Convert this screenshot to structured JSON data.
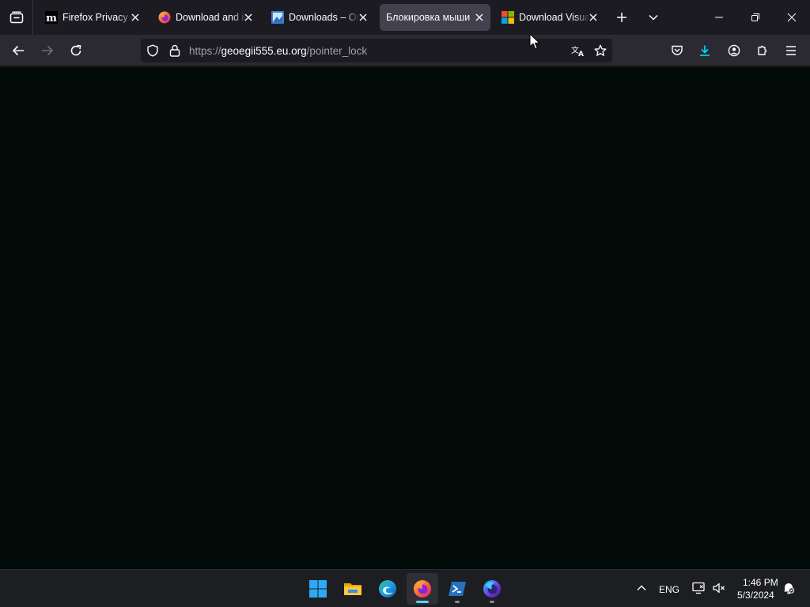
{
  "tabs": [
    {
      "title": "Firefox Privacy Notice",
      "favicon": "mozilla-m-icon",
      "selected": false
    },
    {
      "title": "Download and install",
      "favicon": "firefox-logo-icon",
      "selected": false
    },
    {
      "title": "Downloads – Oracle",
      "favicon": "downloads-image-icon",
      "selected": false
    },
    {
      "title": "Блокировка мыши",
      "favicon": "",
      "selected": true
    },
    {
      "title": "Download Visual",
      "favicon": "microsoft-logo-icon",
      "selected": false
    }
  ],
  "urlbar": {
    "scheme": "https://",
    "host": "geoegii555.eu.org",
    "path": "/pointer_lock"
  },
  "taskbar": {
    "apps": [
      {
        "name": "start",
        "icon": "windows-start-icon",
        "active": false,
        "running": false
      },
      {
        "name": "file-explorer",
        "icon": "folder-icon",
        "active": false,
        "running": false
      },
      {
        "name": "edge",
        "icon": "edge-icon",
        "active": false,
        "running": false
      },
      {
        "name": "firefox",
        "icon": "firefox-icon",
        "active": true,
        "running": true
      },
      {
        "name": "powershell",
        "icon": "powershell-icon",
        "active": false,
        "running": true
      },
      {
        "name": "firefox-nightly",
        "icon": "firefox-nightly-icon",
        "active": false,
        "running": true
      }
    ],
    "tray": {
      "language": "ENG",
      "time": "1:46 PM",
      "date": "5/3/2024"
    }
  },
  "colors": {
    "chrome": "#1c1b22",
    "toolbar": "#2b2a33",
    "selected_tab": "#42414d",
    "content": "#020a08",
    "accent_download": "#00ddff",
    "taskbar": "#1d1e22"
  }
}
